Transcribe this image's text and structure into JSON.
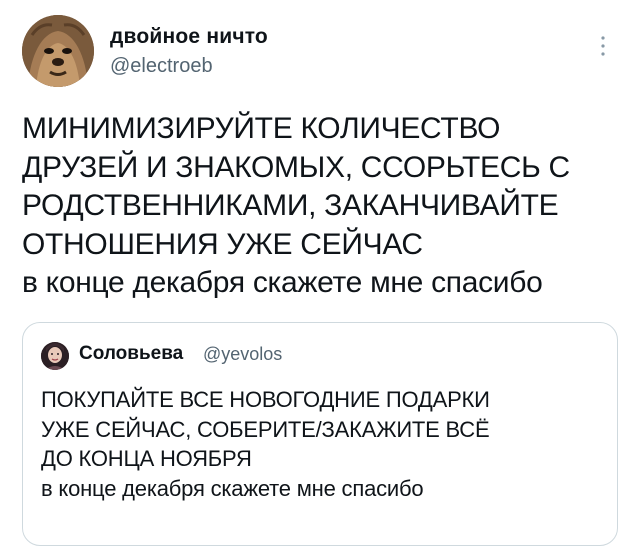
{
  "tweet": {
    "author": {
      "name": "двойное ничто",
      "handle": "@electroeb"
    },
    "text_caps": "МИНИМИЗИРУЙТЕ КОЛИЧЕСТВО\nДРУЗЕЙ И ЗНАКОМЫХ, ССОРЬТЕСЬ С\nРОДСТВЕННИКАМИ, ЗАКАНЧИВАЙТЕ\nОТНОШЕНИЯ УЖЕ СЕЙЧАС",
    "text_tail": "в конце декабря скажете мне спасибо",
    "more_icon": "more-vertical-icon"
  },
  "quote": {
    "author": {
      "name": "Соловьева",
      "handle": "@yevolos"
    },
    "text_caps": "ПОКУПАЙТЕ ВСЕ НОВОГОДНИЕ ПОДАРКИ\nУЖЕ СЕЙЧАС, СОБЕРИТЕ/ЗАКАЖИТЕ ВСЁ\nДО КОНЦА НОЯБРЯ",
    "text_tail": "в конце декабря скажете мне спасибо"
  },
  "colors": {
    "text": "#0f1419",
    "secondary": "#536471",
    "border": "#cfd9de"
  }
}
